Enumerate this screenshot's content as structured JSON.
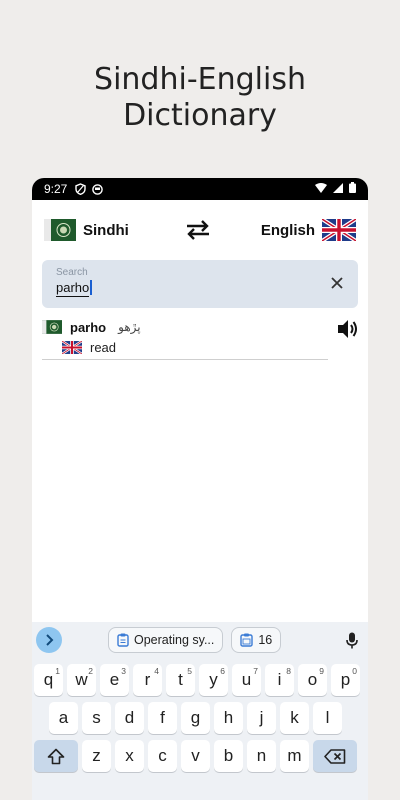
{
  "promo": {
    "line1": "Sindhi-English",
    "line2": "Dictionary"
  },
  "statusbar": {
    "time": "9:27"
  },
  "langbar": {
    "source_lang": "Sindhi",
    "target_lang": "English"
  },
  "search": {
    "placeholder": "Search",
    "value": "parho"
  },
  "results": [
    {
      "word": "parho",
      "sindhi": "پڙهو",
      "translation": "read"
    }
  ],
  "keyboard": {
    "suggestions": [
      {
        "label": "Operating sy..."
      },
      {
        "label": "16"
      }
    ],
    "row1": [
      {
        "k": "q",
        "h": "1"
      },
      {
        "k": "w",
        "h": "2"
      },
      {
        "k": "e",
        "h": "3"
      },
      {
        "k": "r",
        "h": "4"
      },
      {
        "k": "t",
        "h": "5"
      },
      {
        "k": "y",
        "h": "6"
      },
      {
        "k": "u",
        "h": "7"
      },
      {
        "k": "i",
        "h": "8"
      },
      {
        "k": "o",
        "h": "9"
      },
      {
        "k": "p",
        "h": "0"
      }
    ],
    "row2": [
      "a",
      "s",
      "d",
      "f",
      "g",
      "h",
      "j",
      "k",
      "l"
    ],
    "row3": [
      "z",
      "x",
      "c",
      "v",
      "b",
      "n",
      "m"
    ]
  },
  "colors": {
    "accent_blue": "#1a5fd1",
    "search_bg": "#dde4ed",
    "flag_green": "#1f5a2c"
  }
}
